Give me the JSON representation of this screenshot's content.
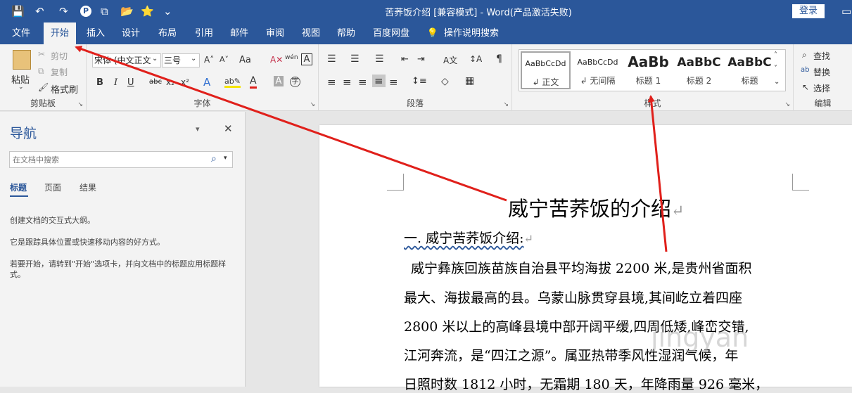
{
  "window": {
    "title": "苦荞饭介绍 [兼容模式]  -  Word(产品激活失败)",
    "login": "登录"
  },
  "quick_access": {
    "save": "💾",
    "undo": "↶",
    "redo": "↷",
    "icons": [
      "P",
      "⧉",
      "📂",
      "⭐",
      "⌄"
    ]
  },
  "window_controls": {
    "restore": "▭",
    "minimize": "—",
    "maximize": "☐",
    "close": "✕"
  },
  "tabs": [
    "文件",
    "开始",
    "插入",
    "设计",
    "布局",
    "引用",
    "邮件",
    "审阅",
    "视图",
    "帮助",
    "百度网盘",
    "操作说明搜索"
  ],
  "active_tab": "开始",
  "clipboard": {
    "paste": "粘贴",
    "cut": "剪切",
    "copy": "复制",
    "format_painter": "格式刷",
    "label": "剪贴板"
  },
  "font": {
    "name": "宋体 (中文正文",
    "size": "三号",
    "label": "字体",
    "grow": "A˄",
    "shrink": "A˅",
    "case": "Aa",
    "clear": "A✕",
    "wen": "wén",
    "border_a": "A",
    "bold": "B",
    "italic": "I",
    "underline": "U",
    "strike": "abc",
    "sub": "x₂",
    "sup": "x²",
    "effects": "A",
    "highlight": "ab✎",
    "color": "A",
    "shade": "A",
    "enclose": "字"
  },
  "paragraph": {
    "label": "段落",
    "bullets": "☰",
    "numbering": "☰",
    "multilevel": "☰",
    "decrease": "⇤",
    "increase": "⇥",
    "chinese": "A文",
    "sort": "↕A",
    "marks": "¶",
    "align_left": "≡",
    "center": "≡",
    "right": "≡",
    "justify": "≡",
    "distributed": "≡",
    "spacing": "↕≡",
    "shading": "◇",
    "borders": "▦"
  },
  "styles": {
    "label": "样式",
    "items": [
      {
        "preview": "AaBbCcDd",
        "name": "↲ 正文"
      },
      {
        "preview": "AaBbCcDd",
        "name": "↲ 无间隔"
      },
      {
        "preview": "AaBb",
        "name": "标题 1"
      },
      {
        "preview": "AaBbC",
        "name": "标题 2"
      },
      {
        "preview": "AaBbC",
        "name": "标题"
      }
    ]
  },
  "editing": {
    "find": "查找",
    "replace": "替换",
    "select": "选择",
    "label": "编辑"
  },
  "nav": {
    "title": "导航",
    "search_placeholder": "在文档中搜索",
    "tabs": [
      "标题",
      "页面",
      "结果"
    ],
    "texts": [
      "创建文档的交互式大纲。",
      "它是跟踪具体位置或快速移动内容的好方式。",
      "若要开始，请转到\"开始\"选项卡，并向文档中的标题应用标题样式。"
    ]
  },
  "document": {
    "heading": "威宁苦荞饭的介绍",
    "subheading": "一. 威宁苦荞饭介绍:",
    "return_mark": "↵",
    "lines": [
      "威宁彝族回族苗族自治县平均海拔  2200  米,是贵州省面积",
      "最大、海拔最高的县。乌蒙山脉贯穿县境,其间屹立着四座",
      "2800 米以上的高峰县境中部开阔平缓,四周低矮,峰峦交错,",
      "江河奔流，是“四江之源”。属亚热带季风性湿润气候，年",
      "日照时数 1812 小时，无霜期 180 天，年降雨量 926 毫米，"
    ]
  },
  "watermark": "jingyan",
  "colors": {
    "brand": "#2b579a",
    "arrow": "#e0201b"
  }
}
